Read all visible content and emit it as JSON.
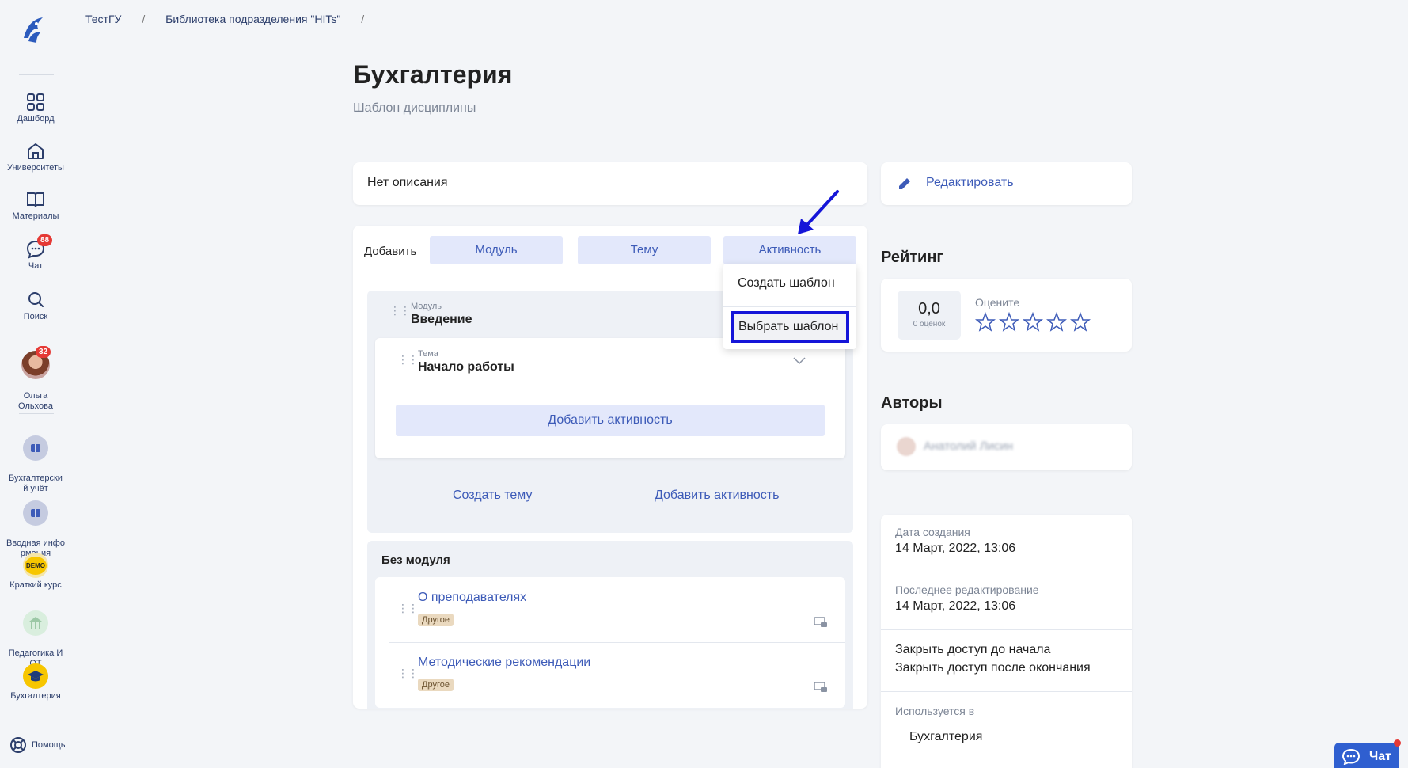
{
  "breadcrumb": {
    "items": [
      "ТестГУ",
      "Библиотека подразделения \"HITs\""
    ],
    "separator": "/"
  },
  "page": {
    "title": "Бухгалтерия",
    "subtitle": "Шаблон дисциплины",
    "description": "Нет описания"
  },
  "sidebar": {
    "items": [
      {
        "label": "Дашборд",
        "icon": "grid-icon"
      },
      {
        "label": "Университеты",
        "icon": "university-icon"
      },
      {
        "label": "Материалы",
        "icon": "book-icon"
      },
      {
        "label": "Чат",
        "icon": "chat-icon",
        "badge": "88"
      },
      {
        "label": "Поиск",
        "icon": "search-icon"
      },
      {
        "label": "Ольга\nОльхова",
        "icon": "avatar",
        "badge": "32"
      }
    ],
    "courses": [
      {
        "label": "Бухгалтерски\nй учёт"
      },
      {
        "label": "Вводная инфо\nрмация"
      },
      {
        "label": "Краткий курс"
      },
      {
        "label": "Педагогика И\nОТ"
      },
      {
        "label": "Бухгалтерия"
      }
    ],
    "help": "Помощь"
  },
  "builder": {
    "add_label": "Добавить",
    "buttons": [
      "Модуль",
      "Тему",
      "Активность"
    ],
    "module": {
      "label": "Модуль",
      "name": "Введение",
      "theme": {
        "label": "Тема",
        "name": "Начало работы",
        "add_activity": "Добавить активность"
      },
      "create_theme": "Создать тему",
      "add_activity": "Добавить активность"
    },
    "no_module": {
      "title": "Без модуля",
      "activities": [
        {
          "title": "О преподавателях",
          "tag": "Другое"
        },
        {
          "title": "Методические рекомендации",
          "tag": "Другое"
        }
      ]
    }
  },
  "dropdown": {
    "items": [
      "Создать шаблон",
      "Выбрать шаблон"
    ],
    "highlight_color": "#1515d8"
  },
  "right": {
    "edit": "Редактировать",
    "rating_title": "Рейтинг",
    "score": "0,0",
    "score_count": "0 оценок",
    "rate_label": "Оцените",
    "stars": 5,
    "authors_title": "Авторы",
    "author_name": "Анатолий Лисин",
    "info": {
      "created_label": "Дата создания",
      "created_value": "14 Март, 2022, 13:06",
      "edited_label": "Последнее редактирование",
      "edited_value": "14 Март, 2022, 13:06",
      "access_before": "Закрыть доступ до начала",
      "access_after": "Закрыть доступ после окончания",
      "used_label": "Используется в",
      "used_value": "Бухгалтерия"
    }
  },
  "chat_button": "Чат",
  "colors": {
    "accent": "#3d5bb8",
    "button_bg": "#e3e8fb",
    "background": "#f3f5f8",
    "badge": "#e53935"
  }
}
